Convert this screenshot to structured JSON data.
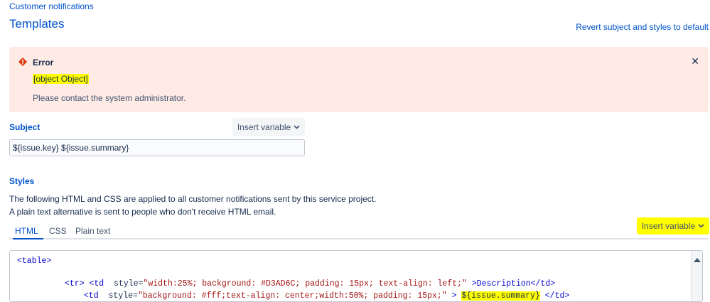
{
  "breadcrumb": "Customer notifications",
  "page_title": "Templates",
  "revert_link": "Revert subject and styles to default",
  "error": {
    "title": "Error",
    "object_text": "[object Object]",
    "message": "Please contact the system administrator.",
    "close_glyph": "✕"
  },
  "subject": {
    "label": "Subject",
    "insert_variable": "Insert variable",
    "value": "${issue.key} ${issue.summary}"
  },
  "styles": {
    "label": "Styles",
    "description": "The following HTML and CSS are applied to all customer notifications sent by this service project. A plain text alternative is sent to people who don't receive HTML email.",
    "tabs": [
      "HTML",
      "CSS",
      "Plain text"
    ],
    "active_tab": "HTML",
    "insert_variable": "Insert variable"
  },
  "code": {
    "line1": "<table>",
    "line2_tag_open": "<tr> <td",
    "line2_attr": "style=",
    "line2_str": "\"width:25%; background: #D3AD6C; padding: 15px; text-align: left;\"",
    "line2_tail": ">Description</td>",
    "line3_tag_open": "<td",
    "line3_attr": "style=",
    "line3_str": "\"background: #fff;text-align: center;width:50%; padding: 15px;\"",
    "line3_gt": ">",
    "line3_var": "${issue.summary}",
    "line3_close": "</td>"
  },
  "icons": {
    "error_icon": "error-diamond",
    "chevron": "chevron-down",
    "close": "close-x"
  },
  "colors": {
    "link": "#0052cc",
    "error_bg": "#ffebe6",
    "error_icon": "#de350b",
    "highlight": "#ffff00"
  }
}
